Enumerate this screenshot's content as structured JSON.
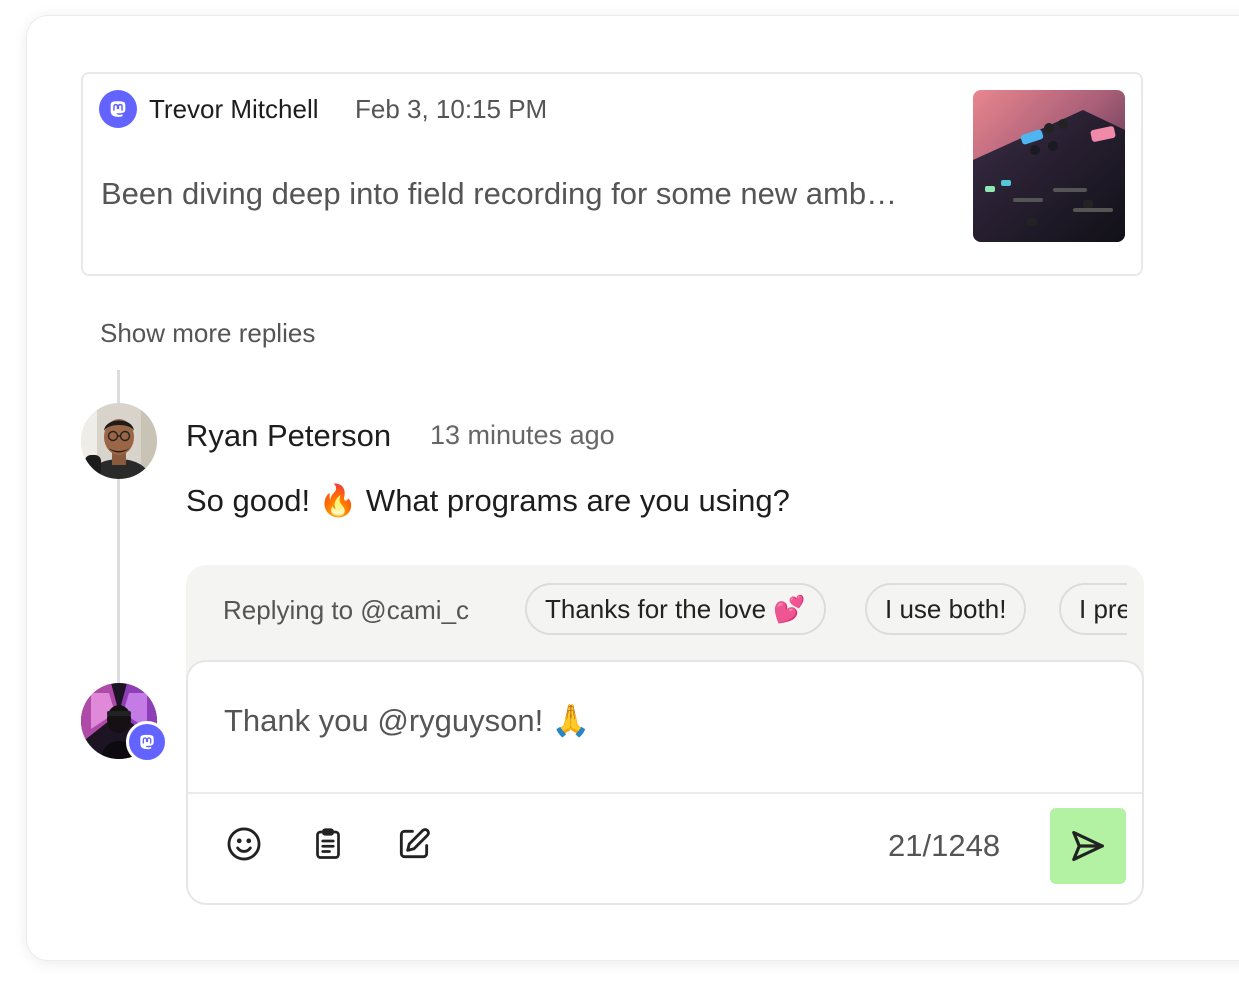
{
  "original_post": {
    "author": "Trevor Mitchell",
    "timestamp": "Feb 3, 10:15 PM",
    "text": "Been diving deep into field recording for some new amb…",
    "network_icon": "mastodon-icon",
    "thumbnail": "mixing-console-image"
  },
  "show_more_label": "Show more replies",
  "reply": {
    "author": "Ryan Peterson",
    "timestamp": "13 minutes ago",
    "text": "So good! 🔥 What programs are you using?"
  },
  "compose": {
    "replying_to": "Replying to @cami_c",
    "suggestions": [
      {
        "label": "Thanks for the love 💕"
      },
      {
        "label": "I use both!"
      },
      {
        "label": "I pre"
      }
    ],
    "draft": "Thank you @ryguyson! 🙏",
    "char_count": "21/1248",
    "tools": [
      "emoji-icon",
      "clipboard-icon",
      "edit-icon"
    ],
    "send_icon": "send-icon"
  },
  "colors": {
    "mastodon": "#6364ff",
    "send_button": "#b3f1a3",
    "compose_bg": "#f4f4f2"
  }
}
